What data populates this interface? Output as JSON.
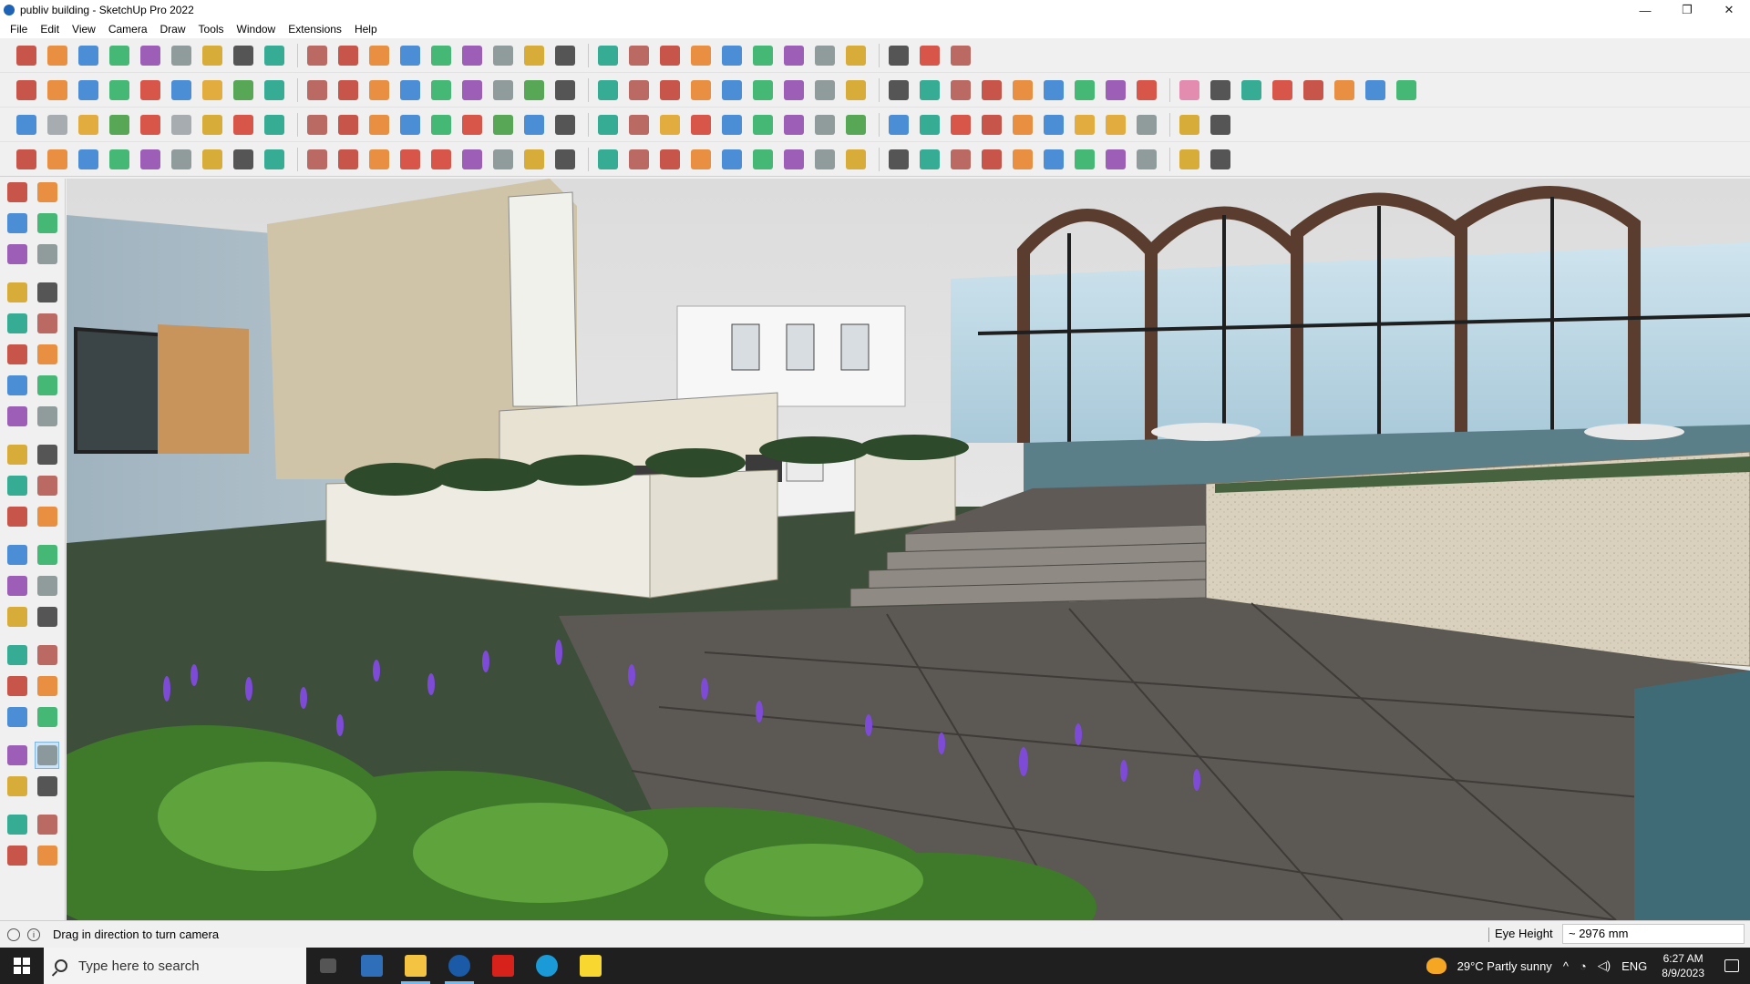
{
  "window": {
    "title": "publiv building - SketchUp Pro 2022",
    "controls": {
      "minimize": "—",
      "maximize": "❐",
      "close": "✕"
    }
  },
  "menu": [
    "File",
    "Edit",
    "View",
    "Camera",
    "Draw",
    "Tools",
    "Window",
    "Extensions",
    "Help"
  ],
  "toolbars": {
    "row1": [
      "zoom-extents-icon",
      "select-icon",
      "eraser-icon",
      "pencil-icon",
      "lasso-icon",
      "rectangle-icon",
      "push-pull-icon",
      "follow-me-icon",
      "move-icon",
      "rotate-icon",
      "scale-icon",
      "tape-measure-icon",
      "text-icon",
      "paint-bucket-icon",
      "orbit-icon",
      "pan-icon",
      "zoom-icon",
      "zoom-window-icon",
      "components-icon",
      "sandbox-icon",
      "layers-icon",
      "styles-icon",
      "section-plane-icon",
      "walk-icon",
      "look-around-icon",
      "extension-warehouse-icon",
      "outliner-icon",
      "undo-icon",
      "redo-icon",
      "scenes-icon"
    ],
    "row2": [
      "cube-iso-icon",
      "cube-top-icon",
      "cube-front-icon",
      "vray-render-icon",
      "red-arrow-icon",
      "blue-arrow-icon",
      "orange-arrow-icon",
      "green-arrow-icon",
      "arrow-n-icon",
      "arrow-x-icon",
      "arrow-f-icon",
      "curve-icon",
      "section-icon",
      "section-fill-icon",
      "section-cut-icon",
      "layer-icon",
      "layer-green-icon",
      "house-icon",
      "house-open-icon",
      "house-roof-icon",
      "house-outline-icon",
      "house-box-icon",
      "fx-icon",
      "shape-icon",
      "marker-icon",
      "ring-icon",
      "circle-icon",
      "hexagon-icon",
      "ellipse-icon",
      "parallelogram-icon",
      "arc-icon",
      "polygon-icon",
      "pencil-lasso-icon",
      "loop-icon",
      "spiral-icon",
      "red-line-icon",
      "eraser-pink-icon",
      "bookmark-icon",
      "grid-icon",
      "red-solid-icon",
      "paint-icon",
      "hand-icon",
      "crate-icon",
      "texture-icon"
    ],
    "row3": [
      "plane-blue-icon",
      "plane-light-icon",
      "plane-yellow-icon",
      "plane-green-icon",
      "plane-red-icon",
      "plane-gray-icon",
      "arc-tool-icon",
      "red-box-icon",
      "list-icon",
      "page-icon",
      "box-icon",
      "wrench-icon",
      "chair-icon",
      "node-line-icon",
      "plus-red-icon",
      "plus-green-icon",
      "cross-blue-icon",
      "cone-icon",
      "flame-icon",
      "warning-icon",
      "lasso-yellow-icon",
      "lasso-red-icon",
      "loop-tool-icon",
      "cross-arrows-icon",
      "bucket-icon",
      "magnet-icon",
      "pipe-green-icon",
      "pipe-blue-icon",
      "stairs-icon",
      "stairs-red-icon",
      "chips-icon",
      "grid-flat-icon",
      "window-icon",
      "grid-orange-icon",
      "grid-yellow-icon",
      "dots-icon",
      "circle-dashed-icon",
      "qr-icon"
    ],
    "row4": [
      "corner-icon",
      "dot-path-icon",
      "car-icon",
      "scissors-icon",
      "gear-icon",
      "cloud-icon",
      "curl-icon",
      "dome-icon",
      "sphere-icon",
      "stretch-icon",
      "corner-line-icon",
      "corner-arc-icon",
      "line-red-icon",
      "arc-red-icon",
      "stair-shape-icon",
      "cone-outline-icon",
      "columns-icon",
      "grid-columns-icon",
      "hand-outline-icon",
      "leaf-icon",
      "plane-wing-icon",
      "stack-icon",
      "ramp-icon",
      "arrows-out-icon",
      "arrows-fork-icon",
      "arrows-right-icon",
      "floor-icon",
      "block-icon",
      "step-icon",
      "fence-icon",
      "hatch-icon",
      "lines-icon",
      "stripes-icon",
      "gear-dark-icon",
      "brace-icon",
      "ramp-dark-icon",
      "tree-icon",
      "diamond-icon"
    ]
  },
  "left_toolbar": [
    [
      "select-arrow-icon",
      "orbit-small-icon"
    ],
    [
      "paint-bucket-small-icon",
      "eraser-small-icon"
    ],
    [
      "components-small-icon",
      "tape-small-icon"
    ],
    [
      "gap"
    ],
    [
      "pencil-small-icon",
      "freehand-icon"
    ],
    [
      "rectangle-small-icon",
      "rotated-rect-icon"
    ],
    [
      "circle-small-icon",
      "polygon-small-icon"
    ],
    [
      "arc-small-icon",
      "pie-icon"
    ],
    [
      "arc-3pt-icon",
      "rotated-arc-icon"
    ],
    [
      "gap"
    ],
    [
      "move-small-icon",
      "push-pull-small-icon"
    ],
    [
      "rotate-small-icon",
      "follow-me-small-icon"
    ],
    [
      "scale-small-icon",
      "offset-icon"
    ],
    [
      "gap"
    ],
    [
      "tape-measure-small-icon",
      "dimension-icon"
    ],
    [
      "protractor-icon",
      "text-small-icon"
    ],
    [
      "axes-icon",
      "3d-text-icon"
    ],
    [
      "gap"
    ],
    [
      "orbit-tool-icon",
      "pan-hand-icon"
    ],
    [
      "zoom-small-icon",
      "zoom-window-small-icon"
    ],
    [
      "zoom-extents-small-icon",
      "previous-view-icon"
    ],
    [
      "gap"
    ],
    [
      "position-camera-icon",
      "look-around-small-icon"
    ],
    [
      "walk-small-icon",
      "section-small-icon"
    ],
    [
      "gap"
    ],
    [
      "warehouse-small-icon",
      "sandbox-small-icon"
    ],
    [
      "layers-small-icon",
      "styles-small-icon"
    ]
  ],
  "status": {
    "message": "Drag in direction to turn camera",
    "measure_label": "Eye Height",
    "measure_value": "~ 2976 mm"
  },
  "taskbar": {
    "search_placeholder": "Type here to search",
    "apps": [
      "task-view-icon",
      "calculator-icon",
      "file-explorer-icon",
      "sketchup-icon",
      "acrobat-icon",
      "edge-icon",
      "sticky-notes-icon"
    ],
    "weather": "29°C  Partly sunny",
    "language": "ENG",
    "time": "6:27 AM",
    "date": "8/9/2023"
  }
}
